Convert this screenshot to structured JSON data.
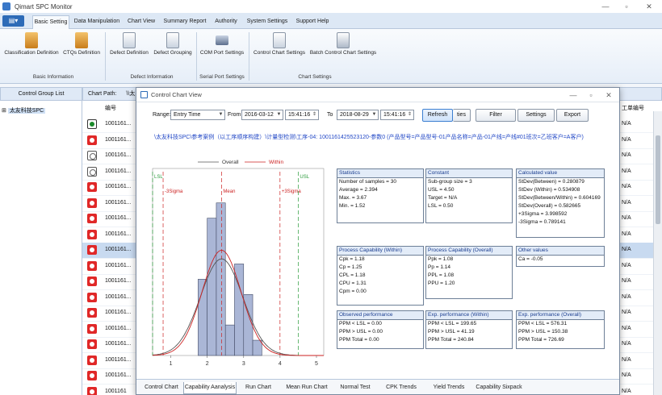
{
  "window": {
    "title": "Qimart SPC Monitor"
  },
  "menu": {
    "app_button": "▤▾",
    "tabs": [
      "Basic Setting",
      "Data Manipulation",
      "Chart View",
      "Summary Report",
      "Authority",
      "System Settings",
      "Support Help"
    ]
  },
  "ribbon": {
    "buttons": [
      "Classification Definition",
      "CTQs Definition",
      "Defect Definition",
      "Defect Grouping",
      "COM Port Settings",
      "Control Chart Settings",
      "Batch Control Chart Settings"
    ],
    "groups": [
      "Basic Information",
      "Defect Information",
      "Serial Port Settings",
      "Chart Settings"
    ]
  },
  "left": {
    "header": "Control Group List",
    "tree_node": "太友科技SPC"
  },
  "main": {
    "path_label": "Chart Path:",
    "path_value": "\\\\太",
    "col_id": "编号",
    "col_right": "工单编号",
    "rows": [
      {
        "id": "1001161...",
        "val": "N/A"
      },
      {
        "id": "1001161...",
        "val": "N/A"
      },
      {
        "id": "1001161...",
        "val": "N/A"
      },
      {
        "id": "1001161...",
        "val": "N/A"
      },
      {
        "id": "1001161...",
        "val": "N/A"
      },
      {
        "id": "1001161...",
        "val": "N/A"
      },
      {
        "id": "1001161...",
        "val": "N/A"
      },
      {
        "id": "1001161...",
        "val": "N/A"
      },
      {
        "id": "1001161...",
        "val": "N/A"
      },
      {
        "id": "1001161...",
        "val": "N/A"
      },
      {
        "id": "1001161...",
        "val": "N/A"
      },
      {
        "id": "1001161...",
        "val": "N/A"
      },
      {
        "id": "1001161...",
        "val": "N/A"
      },
      {
        "id": "1001161...",
        "val": "N/A"
      },
      {
        "id": "1001161...",
        "val": "N/A"
      },
      {
        "id": "1001161...",
        "val": "N/A"
      },
      {
        "id": "1001161...",
        "val": "N/A"
      },
      {
        "id": "1001161",
        "val": "N/A"
      }
    ],
    "row_status": [
      "green",
      "red",
      "white",
      "white",
      "red",
      "red",
      "red",
      "red",
      "red",
      "red",
      "red",
      "red",
      "red",
      "red",
      "red",
      "red",
      "red",
      "red"
    ]
  },
  "dialog": {
    "title": "Control Chart View",
    "range_label": "Range:",
    "range_value": "Entry Time",
    "from_label": "From",
    "from_date": "2016-03-12",
    "from_time": "15:41:16",
    "to_label": "To",
    "to_date": "2018-08-29",
    "to_time": "15:41:16",
    "buttons": [
      "Refresh",
      "ties",
      "Filter",
      "Settings",
      "Export"
    ],
    "description": "\\太友科技SPC\\参考案例（以工序顺序构建）\\计量型检测\\工序-04: 1001161425523120-参数0    (产品型号=产品型号-01产品名称=产品-01产线=产线#01班次=乙班客户=A客户)",
    "bottom_tabs": [
      "Control Chart",
      "Capability Aanalysis",
      "Run Chart",
      "Mean Run Chart",
      "Normal Test",
      "CPK Trends",
      "Yield Trends",
      "Capability Sixpack"
    ]
  },
  "stats_boxes": [
    {
      "title": "Statistics",
      "lines": [
        "Number of samples = 30",
        "Average = 2.394",
        "Max. = 3.67",
        "Min. = 1.52"
      ]
    },
    {
      "title": "Constant",
      "lines": [
        "Sub-group size = 3",
        "USL = 4.50",
        "Target = N/A",
        "LSL = 0.50"
      ]
    },
    {
      "title": "Calculated value",
      "lines": [
        "StDev(Between) = 0.280879",
        "StDev (Within) = 0.534908",
        "StDev(Between/Within) = 0.604169",
        "StDev(Overall) = 0.582665",
        "+3Sigma = 3.998592",
        "-3Sigma = 0.789141"
      ]
    },
    {
      "title": "Process Capability (Within)",
      "lines": [
        "Cpk = 1.18",
        "Cp = 1.25",
        "CPL = 1.18",
        "CPU = 1.31",
        "Cpm = 0.00"
      ]
    },
    {
      "title": "Process Capability (Overall)",
      "lines": [
        "Ppk = 1.08",
        "Pp = 1.14",
        "PPL = 1.08",
        "PPU = 1.20"
      ]
    },
    {
      "title": "Other values",
      "lines": [
        "Ca = -0.05"
      ]
    },
    {
      "title": "Observed performance",
      "lines": [
        "PPM < LSL = 0.00",
        "PPM > USL = 0.00",
        "PPM Total = 0.00"
      ]
    },
    {
      "title": "Exp. performance (Within)",
      "lines": [
        "PPM < LSL = 199.65",
        "PPM > USL = 41.19",
        "PPM Total = 240.84"
      ]
    },
    {
      "title": "Exp. performance (Overall)",
      "lines": [
        "PPM < LSL = 576.31",
        "PPM > USL = 150.38",
        "PPM Total = 726.69"
      ]
    }
  ],
  "chart_data": {
    "type": "bar",
    "title": "",
    "xlabel": "",
    "ylabel": "",
    "legend": [
      "Overall",
      "Within"
    ],
    "legend_placement": "top",
    "xlim": [
      0.5,
      5.2
    ],
    "xticks": [
      "1",
      "2",
      "3",
      "4",
      "5"
    ],
    "bin_edges": [
      1.5,
      1.75,
      2.0,
      2.25,
      2.5,
      2.75,
      3.0,
      3.25,
      3.5,
      3.75
    ],
    "counts": [
      0,
      5,
      9,
      10,
      2,
      6,
      4,
      1,
      0
    ],
    "ref_lines": [
      {
        "label": "LSL",
        "x": 0.5,
        "color": "#2a9a3a"
      },
      {
        "label": "-3Sigma",
        "x": 0.789,
        "color": "#cc2222"
      },
      {
        "label": "Mean",
        "x": 2.394,
        "color": "#cc2222"
      },
      {
        "label": "+3Sigma",
        "x": 3.999,
        "color": "#cc2222"
      },
      {
        "label": "USL",
        "x": 4.5,
        "color": "#2a9a3a"
      }
    ],
    "curves": [
      {
        "name": "Overall",
        "mean": 2.394,
        "sd": 0.582665,
        "color": "#555555"
      },
      {
        "name": "Within",
        "mean": 2.394,
        "sd": 0.534908,
        "color": "#cc2222"
      }
    ],
    "colors": {
      "bar_fill": "#aab6d6",
      "bar_stroke": "#444c66"
    }
  }
}
